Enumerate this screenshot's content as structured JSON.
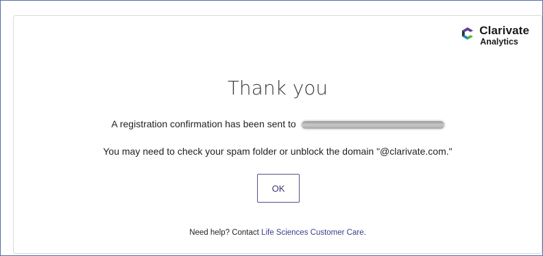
{
  "logo": {
    "brand": "Clarivate",
    "sub": "Analytics"
  },
  "dialog": {
    "title": "Thank you",
    "confirmation_text": "A registration confirmation has been sent to",
    "spam_text": "You may need to check your spam folder or unblock the domain \"@clarivate.com.\"",
    "ok_label": "OK"
  },
  "help": {
    "prefix": "Need help? Contact ",
    "link_text": "Life Sciences Customer Care",
    "suffix": "."
  },
  "colors": {
    "frame_border": "#4a6fa5",
    "button_border": "#5b4a86",
    "link": "#3a3a8c"
  },
  "icons": [
    "clarivate-logo-icon"
  ]
}
